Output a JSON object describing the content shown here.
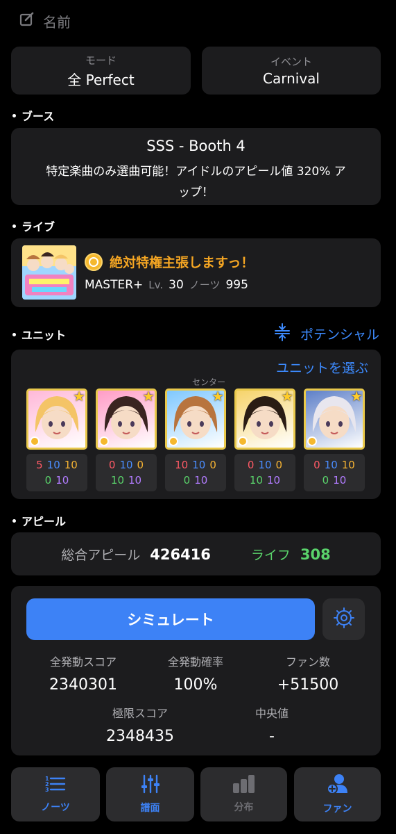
{
  "name_label": "名前",
  "mode": {
    "caption": "モード",
    "value": "全 Perfect"
  },
  "event": {
    "caption": "イベント",
    "value": "Carnival"
  },
  "booth": {
    "section": "ブース",
    "title": "SSS - Booth 4",
    "description_line1": "特定楽曲のみ選曲可能！アイドルのアピール値 320% ア",
    "description_line2": "ップ！"
  },
  "live": {
    "section": "ライブ",
    "song": "絶対特権主張しますっ！",
    "difficulty": "MASTER+",
    "level_label": "Lv.",
    "level": "30",
    "notes_label": "ノーツ",
    "notes": "995"
  },
  "unit": {
    "section": "ユニット",
    "potential_label": "ポテンシャル",
    "select_label": "ユニットを選ぶ",
    "center_label": "センター",
    "idols": [
      {
        "hair": "#f4c466",
        "bg": "#ffb8d8",
        "pot": [
          "5",
          "10",
          "10",
          "0",
          "10"
        ]
      },
      {
        "hair": "#3a2420",
        "bg": "#ff9cc6",
        "pot": [
          "0",
          "10",
          "0",
          "10",
          "10"
        ]
      },
      {
        "hair": "#b8743e",
        "bg": "#7fc8ff",
        "pot": [
          "10",
          "10",
          "0",
          "0",
          "10"
        ]
      },
      {
        "hair": "#2a1c14",
        "bg": "#f6d36a",
        "pot": [
          "0",
          "10",
          "0",
          "10",
          "10"
        ]
      },
      {
        "hair": "#e8e6ee",
        "bg": "#5d7fc8",
        "pot": [
          "0",
          "10",
          "10",
          "0",
          "10"
        ]
      }
    ]
  },
  "appeal": {
    "section": "アピール",
    "total_label": "総合アピール",
    "total": "426416",
    "life_label": "ライフ",
    "life": "308"
  },
  "simulate": {
    "button": "シミュレート",
    "full_combo_score_label": "全発動スコア",
    "full_combo_score": "2340301",
    "full_rate_label": "全発動確率",
    "full_rate": "100%",
    "fans_label": "ファン数",
    "fans": "+51500",
    "limit_score_label": "極限スコア",
    "limit_score": "2348435",
    "median_label": "中央値",
    "median": "-"
  },
  "tabs": [
    {
      "label": "ノーツ",
      "icon": "list-icon"
    },
    {
      "label": "譜面",
      "icon": "sliders-icon"
    },
    {
      "label": "分布",
      "icon": "bar-chart-icon"
    },
    {
      "label": "ファン",
      "icon": "person-add-icon"
    }
  ],
  "colors": {
    "accent": "#3d82f6",
    "card": "#1c1c1e",
    "life": "#5ad36b",
    "song": "#f5a623"
  }
}
